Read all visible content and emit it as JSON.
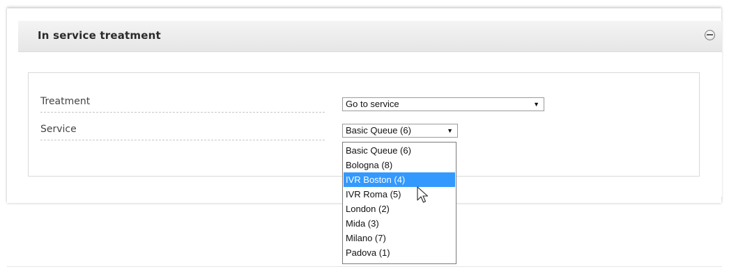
{
  "section": {
    "title": "In service treatment",
    "collapse_icon": "minus-circle-icon"
  },
  "form": {
    "treatment": {
      "label": "Treatment",
      "selected": "Go to service"
    },
    "service": {
      "label": "Service",
      "selected": "Basic Queue (6)",
      "options": [
        "Basic Queue (6)",
        "Bologna (8)",
        "IVR Boston (4)",
        "IVR Roma (5)",
        "London (2)",
        "Mida (3)",
        "Milano (7)",
        "Padova (1)"
      ],
      "highlighted_option": "IVR Boston (4)"
    }
  },
  "colors": {
    "highlight": "#3399ff",
    "header_bg": "#ececec"
  },
  "icons": {
    "dropdown_arrow": "caret-down-icon",
    "pointer": "mouse-cursor-icon"
  }
}
